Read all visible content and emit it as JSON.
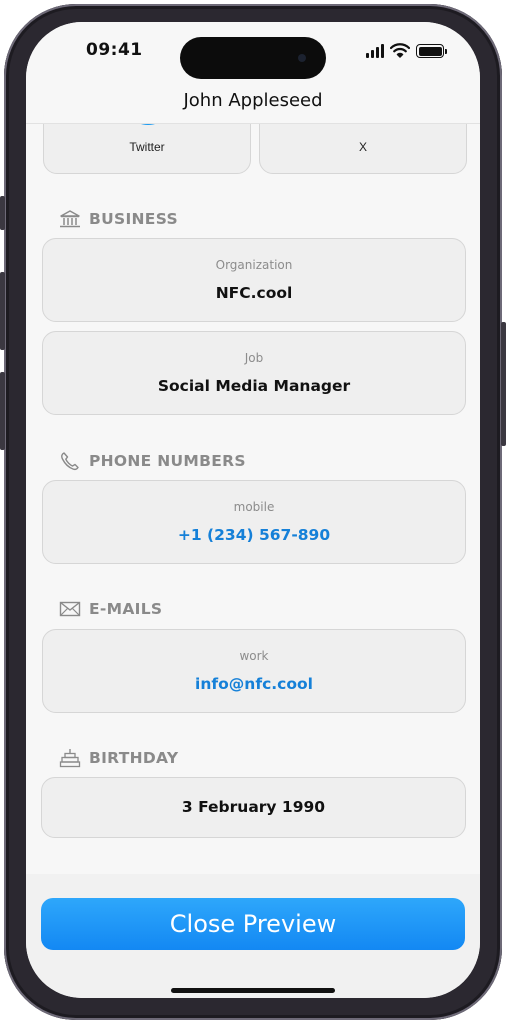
{
  "status_bar": {
    "time": "09:41"
  },
  "header": {
    "title": "John Appleseed"
  },
  "social": [
    {
      "label": "Twitter",
      "icon": "twitter-icon"
    },
    {
      "label": "X",
      "icon": "x-icon"
    }
  ],
  "business": {
    "title": "BUSINESS",
    "icon": "bank-icon",
    "organization_label": "Organization",
    "organization_value": "NFC.cool",
    "job_label": "Job",
    "job_value": "Social Media Manager"
  },
  "phone": {
    "title": "PHONE NUMBERS",
    "icon": "phone-icon",
    "label": "mobile",
    "value": "+1 (234) 567-890"
  },
  "email": {
    "title": "E-MAILS",
    "icon": "envelope-icon",
    "label": "work",
    "value": "info@nfc.cool"
  },
  "birthday": {
    "title": "BIRTHDAY",
    "icon": "cake-icon",
    "value": "3 February 1990"
  },
  "footer": {
    "close_label": "Close Preview"
  },
  "colors": {
    "accent": "#1580d8",
    "button": "#1a8ff5",
    "section_title": "#8a8a8a",
    "card_bg": "#efefef"
  }
}
